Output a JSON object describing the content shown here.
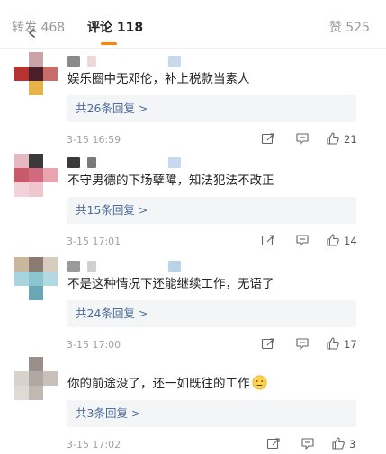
{
  "tabs": {
    "repost": "转发 468",
    "comment": "评论 118",
    "like": "赞 525"
  },
  "comments": [
    {
      "text": "娱乐圈中无邓伦，补上税款当素人",
      "replies": "共26条回复 >",
      "time": "3-15 16:59",
      "likes": "21",
      "avatar_colors": [
        "#ffffff",
        "#c9a5a9",
        "#ffffff",
        "#b53333",
        "#4a1f2a",
        "#c86b6b",
        "#ffffff",
        "#e8b24a",
        "#ffffff"
      ],
      "name_colors": [
        "#8a8a8a",
        "#f0d8d8",
        "#c8d8ee"
      ]
    },
    {
      "text": "不守男德的下场孽障，知法犯法不改正",
      "replies": "共15条回复 >",
      "time": "3-15 17:01",
      "likes": "14",
      "avatar_colors": [
        "#e6b8c0",
        "#3a3a3a",
        "#ffffff",
        "#c95a6a",
        "#d06a7e",
        "#e9a4b0",
        "#f2d2d8",
        "#f0c5cd",
        "#ffffff"
      ],
      "name_colors": [
        "#3a3a3a",
        "#7a7a7a",
        "#c8d8ee"
      ]
    },
    {
      "text": "不是这种情况下还能继续工作，无语了",
      "replies": "共24条回复 >",
      "time": "3-15 17:00",
      "likes": "17",
      "avatar_colors": [
        "#c9b7a0",
        "#8a7a72",
        "#d8ccc0",
        "#a8d4de",
        "#8cc4d0",
        "#b4d8e2",
        "#ffffff",
        "#6aa6b4",
        "#ffffff"
      ],
      "name_colors": [
        "#9a9a9a",
        "#d0d0d0",
        "#b8d4e8"
      ]
    },
    {
      "text": "你的前途没了，还一如既往的工作",
      "replies": "共3条回复 >",
      "time": "3-15 17:02",
      "likes": "3",
      "avatar_colors": [
        "#ffffff",
        "#9a8f8a",
        "#ffffff",
        "#d8d2cc",
        "#b0a8a2",
        "#c8c0ba",
        "#e0dad4",
        "#c0b8b2",
        "#ffffff"
      ],
      "name_colors": [],
      "emoji": "speechless-face"
    }
  ]
}
